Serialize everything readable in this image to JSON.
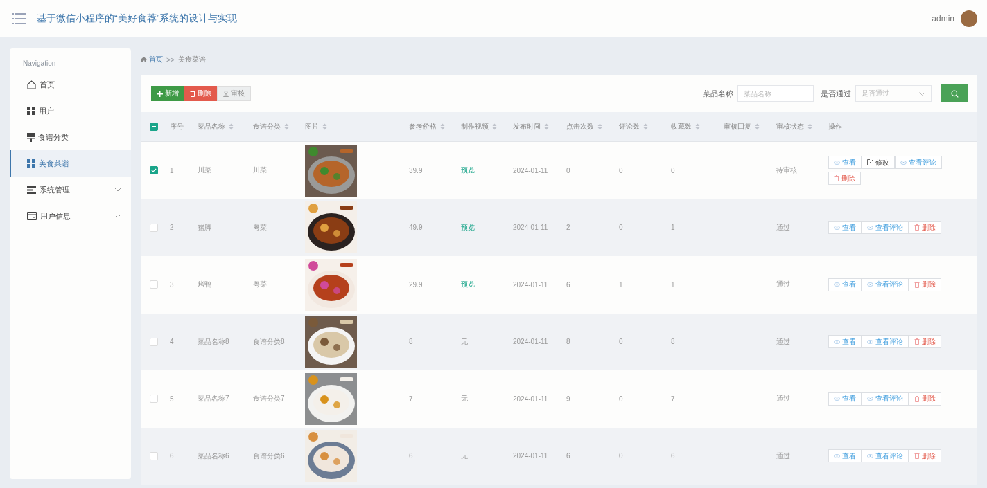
{
  "header": {
    "title": "基于微信小程序的“美好食荐”系统的设计与实现",
    "user": "admin"
  },
  "sidebar": {
    "heading": "Navigation",
    "items": [
      {
        "label": "首页",
        "kind": "home",
        "selected": false,
        "expandable": false
      },
      {
        "label": "用户",
        "kind": "grid",
        "selected": false,
        "expandable": false
      },
      {
        "label": "食谱分类",
        "kind": "brush",
        "selected": false,
        "expandable": false
      },
      {
        "label": "美食菜谱",
        "kind": "grid",
        "selected": true,
        "expandable": false
      },
      {
        "label": "系统管理",
        "kind": "lines",
        "selected": false,
        "expandable": true
      },
      {
        "label": "用户信息",
        "kind": "card",
        "selected": false,
        "expandable": true
      }
    ]
  },
  "breadcrumb": {
    "home": "首页",
    "separator": ">>",
    "current": "美食菜谱"
  },
  "toolbar": {
    "buttons": [
      {
        "label": "新增",
        "kind": "add"
      },
      {
        "label": "删除",
        "kind": "delete"
      },
      {
        "label": "审核",
        "kind": "audit"
      }
    ],
    "filters": [
      {
        "label": "菜品名称",
        "kind": "input",
        "placeholder": "菜品名称"
      },
      {
        "label": "是否通过",
        "kind": "select",
        "placeholder": "是否通过"
      }
    ]
  },
  "table": {
    "header_checkbox": {
      "indeterminate": true
    },
    "columns": [
      {
        "label": "序号",
        "sortable": false
      },
      {
        "label": "菜品名称",
        "sortable": true
      },
      {
        "label": "食谱分类",
        "sortable": true
      },
      {
        "label": "图片",
        "sortable": true
      },
      {
        "label": "参考价格",
        "sortable": true
      },
      {
        "label": "制作视频",
        "sortable": true
      },
      {
        "label": "发布时间",
        "sortable": true
      },
      {
        "label": "点击次数",
        "sortable": true
      },
      {
        "label": "评论数",
        "sortable": true
      },
      {
        "label": "收藏数",
        "sortable": true
      },
      {
        "label": "审核回复",
        "sortable": true
      },
      {
        "label": "审核状态",
        "sortable": true
      },
      {
        "label": "操作",
        "sortable": false
      }
    ],
    "rows": [
      {
        "selected": true,
        "index": "1",
        "name": "川菜",
        "category": "川菜",
        "picture": {
          "kind": "picture"
        },
        "price": "39.9",
        "video": {
          "text": "预览",
          "kind": "link"
        },
        "date": "2024-01-11",
        "clicks": "0",
        "comments": "0",
        "favorites": "0",
        "status": "待审核",
        "actions": [
          {
            "label": "查看",
            "kind": "view"
          },
          {
            "label": "修改",
            "kind": "edit"
          },
          {
            "label": "查看评论",
            "kind": "comments"
          },
          {
            "label": "删除",
            "kind": "delete"
          }
        ]
      },
      {
        "selected": false,
        "index": "2",
        "name": "猪脚",
        "category": "粤菜",
        "picture": {
          "kind": "picture"
        },
        "price": "49.9",
        "video": {
          "text": "预览",
          "kind": "link"
        },
        "date": "2024-01-11",
        "clicks": "2",
        "comments": "0",
        "favorites": "1",
        "status": "通过",
        "actions": [
          {
            "label": "查看",
            "kind": "view"
          },
          {
            "label": "查看评论",
            "kind": "comments"
          },
          {
            "label": "删除",
            "kind": "delete"
          }
        ]
      },
      {
        "selected": false,
        "index": "3",
        "name": "烤鸭",
        "category": "粤菜",
        "picture": {
          "kind": "picture"
        },
        "price": "29.9",
        "video": {
          "text": "预览",
          "kind": "link"
        },
        "date": "2024-01-11",
        "clicks": "6",
        "comments": "1",
        "favorites": "1",
        "status": "通过",
        "actions": [
          {
            "label": "查看",
            "kind": "view"
          },
          {
            "label": "查看评论",
            "kind": "comments"
          },
          {
            "label": "删除",
            "kind": "delete"
          }
        ]
      },
      {
        "selected": false,
        "index": "4",
        "name": "菜品名称8",
        "category": "食谱分类8",
        "picture": {
          "kind": "picture"
        },
        "price": "8",
        "video": {
          "text": "无",
          "kind": "plain"
        },
        "date": "2024-01-11",
        "clicks": "8",
        "comments": "0",
        "favorites": "8",
        "status": "通过",
        "actions": [
          {
            "label": "查看",
            "kind": "view"
          },
          {
            "label": "查看评论",
            "kind": "comments"
          },
          {
            "label": "删除",
            "kind": "delete"
          }
        ]
      },
      {
        "selected": false,
        "index": "5",
        "name": "菜品名称7",
        "category": "食谱分类7",
        "picture": {
          "kind": "picture"
        },
        "price": "7",
        "video": {
          "text": "无",
          "kind": "plain"
        },
        "date": "2024-01-11",
        "clicks": "9",
        "comments": "0",
        "favorites": "7",
        "status": "通过",
        "actions": [
          {
            "label": "查看",
            "kind": "view"
          },
          {
            "label": "查看评论",
            "kind": "comments"
          },
          {
            "label": "删除",
            "kind": "delete"
          }
        ]
      },
      {
        "selected": false,
        "index": "6",
        "name": "菜品名称6",
        "category": "食谱分类6",
        "picture": {
          "kind": "picture"
        },
        "price": "6",
        "video": {
          "text": "无",
          "kind": "plain"
        },
        "date": "2024-01-11",
        "clicks": "6",
        "comments": "0",
        "favorites": "6",
        "status": "通过",
        "actions": [
          {
            "label": "查看",
            "kind": "view"
          },
          {
            "label": "查看评论",
            "kind": "comments"
          },
          {
            "label": "删除",
            "kind": "delete"
          }
        ]
      }
    ]
  }
}
